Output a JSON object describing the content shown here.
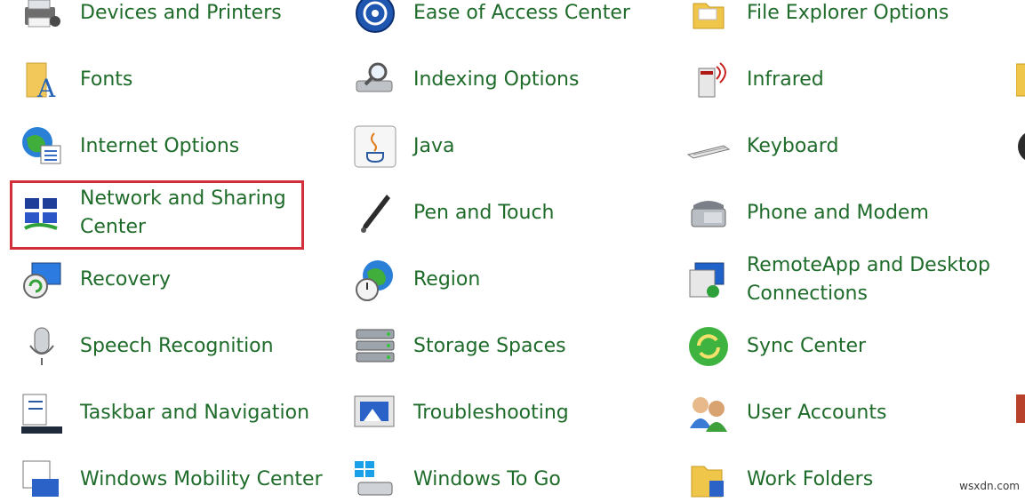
{
  "accent_color": "#1e6b2a",
  "highlight_color": "#d32f3a",
  "items": [
    {
      "label": "Devices and Printers",
      "icon": "devices-printers-icon"
    },
    {
      "label": "Ease of Access Center",
      "icon": "ease-of-access-icon"
    },
    {
      "label": "File Explorer Options",
      "icon": "folder-options-icon"
    },
    {
      "label": "Fonts",
      "icon": "fonts-icon"
    },
    {
      "label": "Indexing Options",
      "icon": "indexing-icon"
    },
    {
      "label": "Infrared",
      "icon": "infrared-icon"
    },
    {
      "label": "Internet Options",
      "icon": "internet-options-icon"
    },
    {
      "label": "Java",
      "icon": "java-icon"
    },
    {
      "label": "Keyboard",
      "icon": "keyboard-icon"
    },
    {
      "label": "Network and Sharing Center",
      "icon": "network-sharing-icon"
    },
    {
      "label": "Pen and Touch",
      "icon": "pen-icon"
    },
    {
      "label": "Phone and Modem",
      "icon": "phone-icon"
    },
    {
      "label": "Recovery",
      "icon": "recovery-icon"
    },
    {
      "label": "Region",
      "icon": "region-icon"
    },
    {
      "label": "RemoteApp and Desktop Connections",
      "icon": "remoteapp-icon"
    },
    {
      "label": "Speech Recognition",
      "icon": "microphone-icon"
    },
    {
      "label": "Storage Spaces",
      "icon": "storage-icon"
    },
    {
      "label": "Sync Center",
      "icon": "sync-icon"
    },
    {
      "label": "Taskbar and Navigation",
      "icon": "taskbar-icon"
    },
    {
      "label": "Troubleshooting",
      "icon": "troubleshooting-icon"
    },
    {
      "label": "User Accounts",
      "icon": "users-icon"
    },
    {
      "label": "Windows Mobility Center",
      "icon": "mobility-icon"
    },
    {
      "label": "Windows To Go",
      "icon": "windows-to-go-icon"
    },
    {
      "label": "Work Folders",
      "icon": "work-folders-icon"
    }
  ],
  "watermark": "wsxdn.com"
}
